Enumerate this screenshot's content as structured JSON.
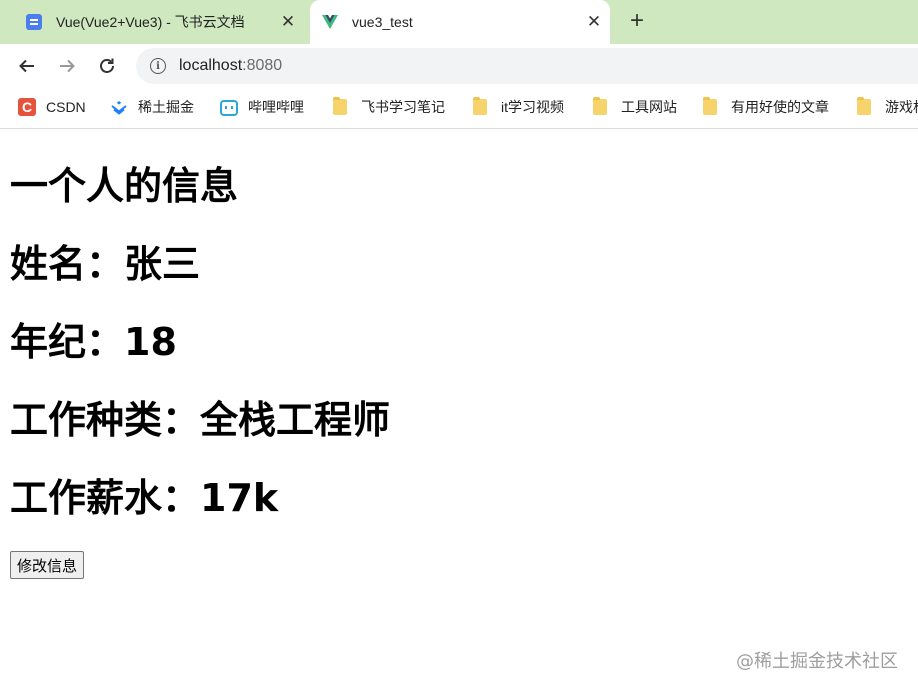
{
  "tabs": [
    {
      "title": "Vue(Vue2+Vue3) - 飞书云文档",
      "icon": "document-icon",
      "active": false
    },
    {
      "title": "vue3_test",
      "icon": "vue-logo-icon",
      "active": true
    }
  ],
  "toolbar": {
    "url_host": "localhost",
    "url_port": ":8080"
  },
  "bookmarks": [
    {
      "label": "CSDN",
      "icon": "csdn-icon"
    },
    {
      "label": "稀土掘金",
      "icon": "juejin-icon"
    },
    {
      "label": "哔哩哔哩",
      "icon": "bilibili-icon"
    },
    {
      "label": "飞书学习笔记",
      "icon": "folder-icon"
    },
    {
      "label": "it学习视频",
      "icon": "folder-icon"
    },
    {
      "label": "工具网站",
      "icon": "folder-icon"
    },
    {
      "label": "有用好使的文章",
      "icon": "folder-icon"
    },
    {
      "label": "游戏杯",
      "icon": "folder-icon"
    }
  ],
  "page": {
    "heading": "一个人的信息",
    "name_line": "姓名：张三",
    "age_line": "年纪：18",
    "job_type_line": "工作种类：全栈工程师",
    "salary_line": "工作薪水：17k",
    "edit_button": "修改信息"
  },
  "watermark": "@稀土掘金技术社区",
  "colors": {
    "tabstrip": "#cfe8c0",
    "vue_green": "#41b883",
    "vue_dark": "#35495e"
  }
}
